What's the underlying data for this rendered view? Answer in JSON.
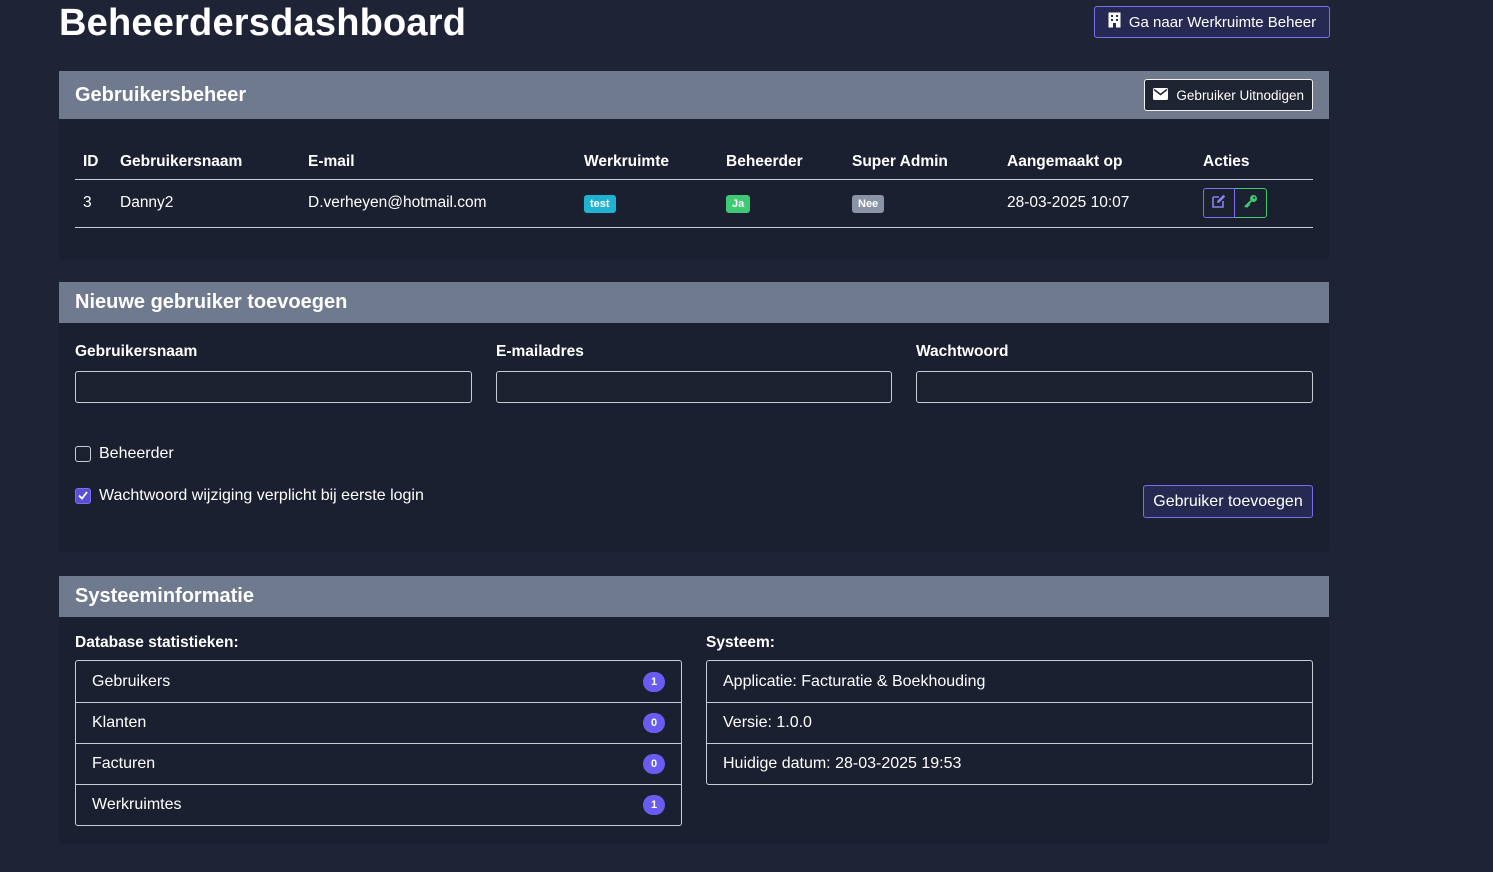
{
  "page": {
    "title": "Beheerdersdashboard"
  },
  "header": {
    "workspace_button": "Ga naar Werkruimte Beheer"
  },
  "user_management": {
    "title": "Gebruikersbeheer",
    "invite_button": "Gebruiker Uitnodigen",
    "columns": [
      "ID",
      "Gebruikersnaam",
      "E-mail",
      "Werkruimte",
      "Beheerder",
      "Super Admin",
      "Aangemaakt op",
      "Acties"
    ],
    "rows": [
      {
        "id": "3",
        "username": "Danny2",
        "email": "D.verheyen@hotmail.com",
        "workspace": "test",
        "admin": "Ja",
        "super_admin": "Nee",
        "created": "28-03-2025 10:07"
      }
    ]
  },
  "new_user": {
    "title": "Nieuwe gebruiker toevoegen",
    "username_label": "Gebruikersnaam",
    "email_label": "E-mailadres",
    "password_label": "Wachtwoord",
    "username_value": "",
    "email_value": "",
    "password_value": "",
    "admin_checkbox_label": "Beheerder",
    "admin_checked": false,
    "force_password_label": "Wachtwoord wijziging verplicht bij eerste login",
    "force_password_checked": true,
    "submit_button": "Gebruiker toevoegen"
  },
  "system_info": {
    "title": "Systeeminformatie",
    "db_stats_label": "Database statistieken:",
    "db_stats": [
      {
        "label": "Gebruikers",
        "count": "1"
      },
      {
        "label": "Klanten",
        "count": "0"
      },
      {
        "label": "Facturen",
        "count": "0"
      },
      {
        "label": "Werkruimtes",
        "count": "1"
      }
    ],
    "system_label": "Systeem:",
    "system_items": [
      "Applicatie: Facturatie & Boekhouding",
      "Versie: 1.0.0",
      "Huidige datum: 28-03-2025 19:53"
    ]
  },
  "colors": {
    "background": "#1e2435",
    "header": "#707a8e",
    "accent": "#7b6ff0",
    "success": "#3fc972",
    "info": "#20b2d0"
  },
  "icons": {
    "workspace": "building-icon",
    "invite": "envelope-icon",
    "edit": "edit-icon",
    "key": "key-icon",
    "check": "check-icon"
  }
}
